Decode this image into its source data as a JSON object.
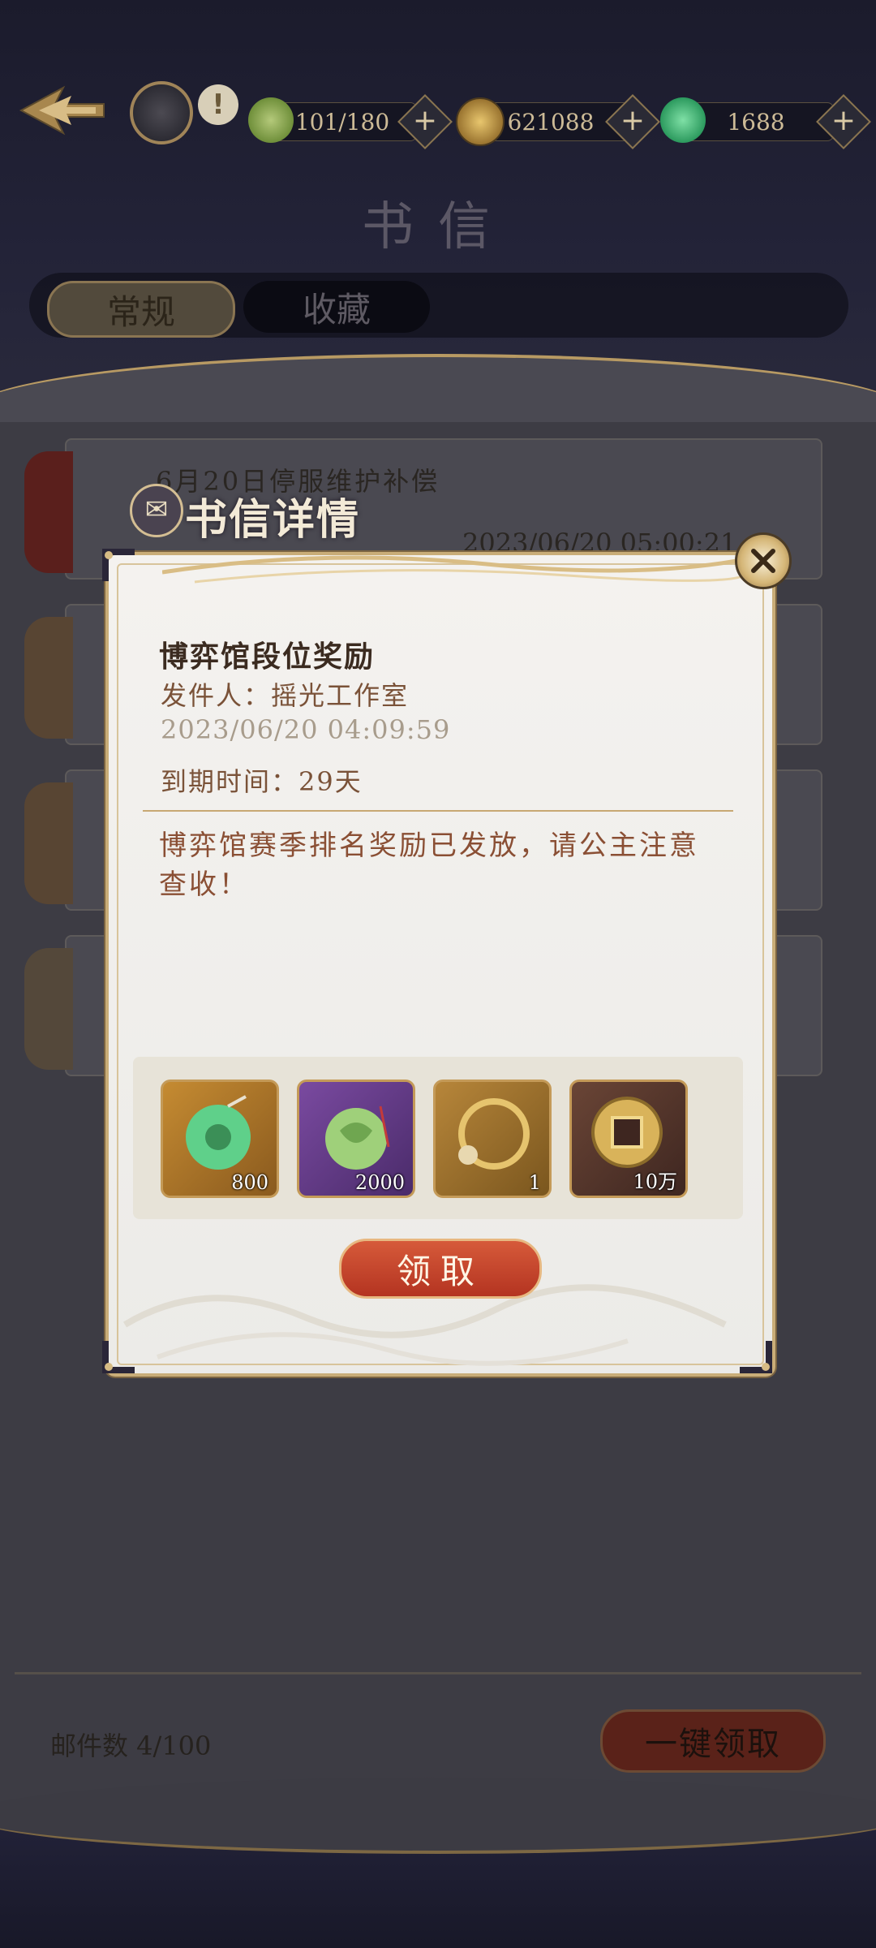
{
  "header": {
    "title": "书信",
    "resources": [
      {
        "name": "stamina",
        "value": "101/180",
        "icon": "tea-leaf-icon"
      },
      {
        "name": "coins",
        "value": "621088",
        "icon": "copper-coin-icon"
      },
      {
        "name": "jade",
        "value": "1688",
        "icon": "jade-gem-icon"
      }
    ],
    "plus": "+",
    "alert": "!"
  },
  "tabs": [
    {
      "label": "常规",
      "active": true
    },
    {
      "label": "收藏",
      "active": false
    }
  ],
  "background_list": {
    "first_mail_title": "6月20日停服维护补偿",
    "first_mail_date": "2023/06/20 05:00:21",
    "mail_count": "邮件数 4/100",
    "claim_all_label": "一键领取"
  },
  "modal": {
    "header": "书信详情",
    "title": "博弈馆段位奖励",
    "sender_label": "发件人：",
    "sender": "摇光工作室",
    "date": "2023/06/20 04:09:59",
    "expiry_label": "到期时间：",
    "expiry": "29天",
    "body": "博弈馆赛季排名奖励已发放，请公主注意查收！",
    "rewards": [
      {
        "icon": "green-jade-pendant-icon",
        "qty": "800"
      },
      {
        "icon": "jade-beast-amulet-icon",
        "qty": "2000"
      },
      {
        "icon": "golden-ring-frame-icon",
        "qty": "1"
      },
      {
        "icon": "gold-coin-icon",
        "qty": "10万"
      }
    ],
    "claim_label": "领取"
  },
  "colors": {
    "accent_gold": "#c9ad78",
    "claim_red": "#c4432a",
    "text_brown": "#7a5238"
  }
}
